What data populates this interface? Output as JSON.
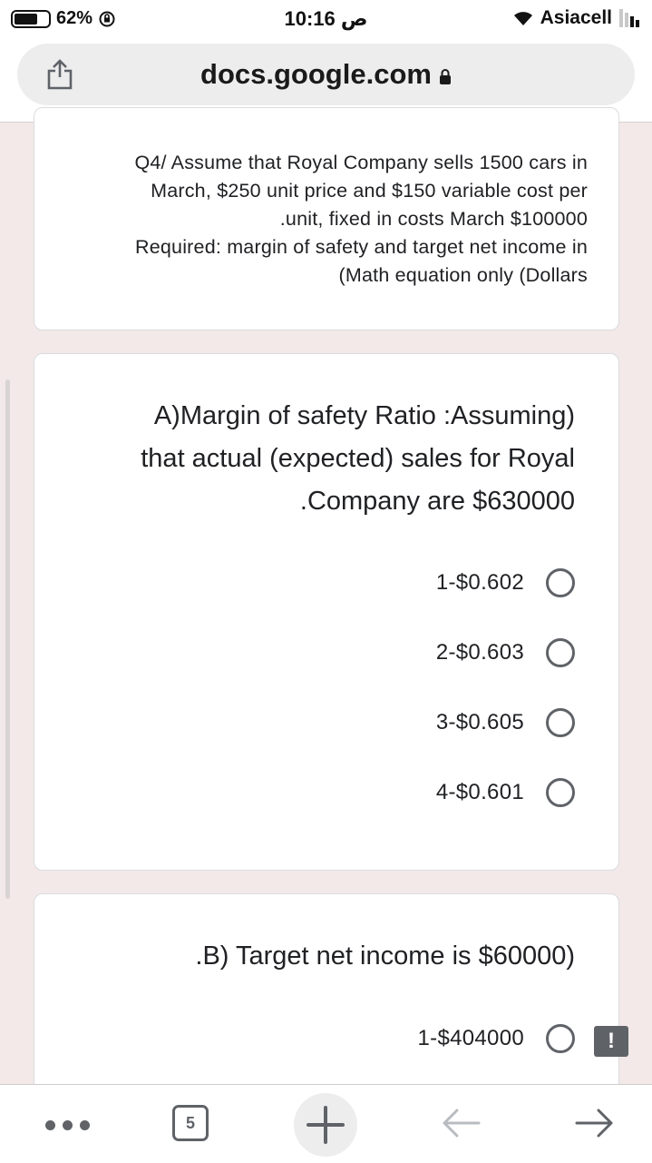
{
  "status_bar": {
    "battery": "62%",
    "time": "10:16 ص",
    "carrier": "Asiacell"
  },
  "browser": {
    "url": "docs.google.com",
    "tab_count": "5"
  },
  "question_card": {
    "lines": [
      "Q4/ Assume that Royal Company sells 1500 cars in",
      "March, $250 unit price and $150 variable cost per",
      ".unit, fixed in costs March $100000",
      "Required: margin of safety and target net income in",
      "(Math equation only (Dollars"
    ]
  },
  "part_a": {
    "title_lines": [
      "A)Margin of safety Ratio :Assuming)",
      "that actual (expected) sales for Royal",
      ".Company are $630000"
    ],
    "options": [
      "1-$0.602",
      "2-$0.603",
      "3-$0.605",
      "4-$0.601"
    ]
  },
  "part_b": {
    "title": ".B) Target net income is $60000)",
    "options": [
      "1-$404000"
    ]
  },
  "colors": {
    "page_background": "#f2e9e8",
    "card_background": "#ffffff",
    "radio_border": "#5f6368"
  }
}
